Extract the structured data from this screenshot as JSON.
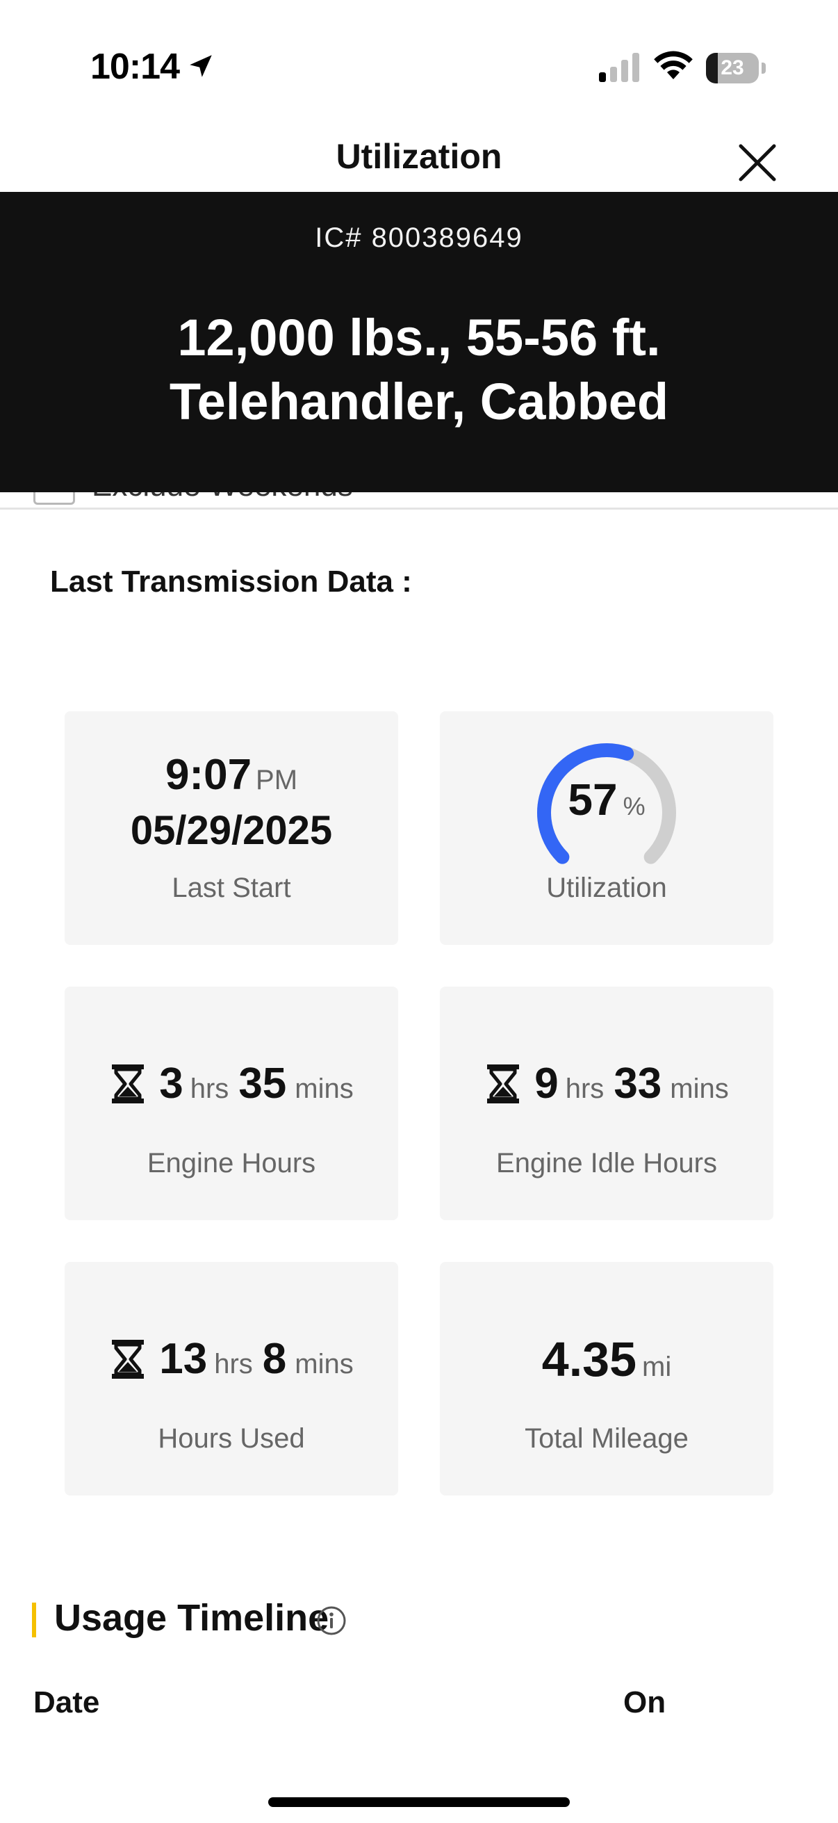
{
  "status_bar": {
    "time": "10:14",
    "battery_level": "23",
    "battery_fraction": 0.23,
    "location_icon": "location-arrow-icon",
    "signal_icon": "cell-signal-icon",
    "wifi_icon": "wifi-icon"
  },
  "nav": {
    "title": "Utilization",
    "close_icon": "close-icon"
  },
  "header": {
    "ic_number": "IC# 800389649",
    "equipment_title": "12,000 lbs., 55-56 ft. Telehandler, Cabbed"
  },
  "filters": {
    "exclude_weekends_label": "Exclude Weekends",
    "exclude_weekends_checked": false
  },
  "last_transmission": {
    "section_label": "Last Transmission Data :",
    "last_start": {
      "time": "9:07",
      "meridiem": "PM",
      "date": "05/29/2025",
      "label": "Last Start"
    },
    "utilization": {
      "value": "57",
      "value_fraction": 0.57,
      "unit": "%",
      "label": "Utilization",
      "colors": {
        "filled": "#3366f5",
        "track": "#cfcfcf"
      }
    },
    "engine_hours": {
      "hours": "3",
      "hours_unit": "hrs",
      "mins": "35",
      "mins_unit": "mins",
      "label": "Engine Hours",
      "icon": "hourglass-icon"
    },
    "engine_idle_hours": {
      "hours": "9",
      "hours_unit": "hrs",
      "mins": "33",
      "mins_unit": "mins",
      "label": "Engine Idle Hours",
      "icon": "hourglass-icon"
    },
    "hours_used": {
      "hours": "13",
      "hours_unit": "hrs",
      "mins": "8",
      "mins_unit": "mins",
      "label": "Hours Used",
      "icon": "hourglass-icon"
    },
    "total_mileage": {
      "value": "4.35",
      "unit": "mi",
      "label": "Total Mileage"
    }
  },
  "usage_timeline": {
    "title": "Usage Timeline",
    "info_icon": "info-icon",
    "accent_color": "#f5c000",
    "columns": [
      "Date",
      "On"
    ]
  }
}
